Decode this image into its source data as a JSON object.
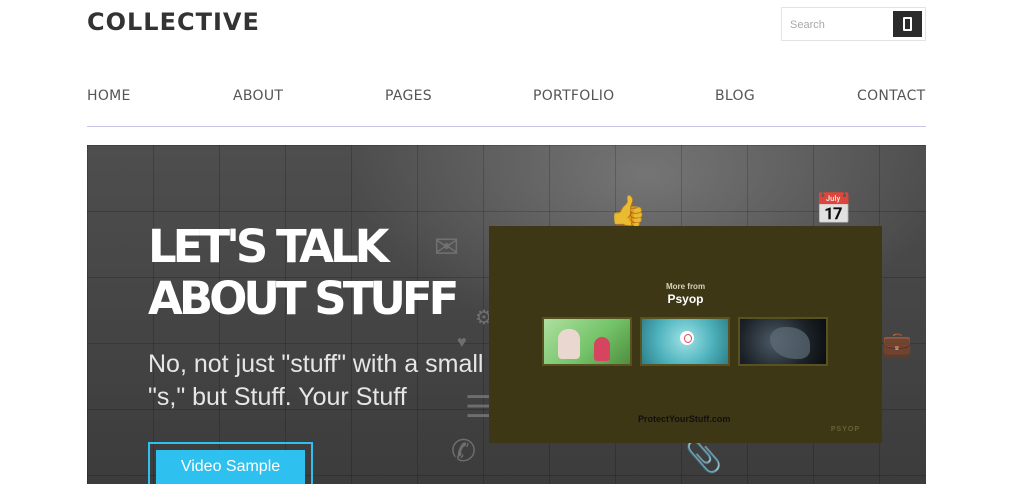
{
  "header": {
    "logo": "COLLECTIVE",
    "search_placeholder": "Search"
  },
  "nav": {
    "items": [
      {
        "label": "HOME"
      },
      {
        "label": "ABOUT"
      },
      {
        "label": "PAGES"
      },
      {
        "label": "PORTFOLIO"
      },
      {
        "label": "BLOG"
      },
      {
        "label": "CONTACT"
      }
    ]
  },
  "hero": {
    "title_line1": "LET'S TALK",
    "title_line2": "ABOUT STUFF",
    "subtitle": "No, not just \"stuff\" with a small \"s,\" but Stuff. Your Stuff",
    "button_label": "Video Sample"
  },
  "video_embed": {
    "more_from": "More from",
    "brand": "Psyop",
    "url_text": "ProtectYourStuff.com",
    "watermark": "PSYOP"
  },
  "colors": {
    "accent": "#2ec0ef",
    "nav_underline": "#c9c2e6",
    "embed_bg": "#3e3716"
  }
}
